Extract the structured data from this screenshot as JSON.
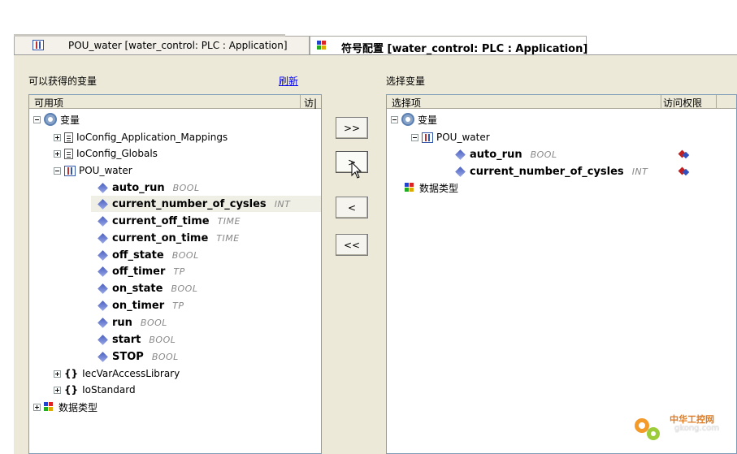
{
  "tabs": [
    {
      "label": "POU_water [water_control: PLC : Application]"
    },
    {
      "label": "符号配置 [water_control: PLC : Application]"
    }
  ],
  "left": {
    "title": "可以获得的变量",
    "refresh_label": "刷新",
    "col_items": "可用项",
    "col_access": "访|",
    "tree": {
      "root": "变量",
      "n1": "IoConfig_Application_Mappings",
      "n2": "IoConfig_Globals",
      "n3": "POU_water",
      "vars": [
        {
          "name": "auto_run",
          "type": "BOOL"
        },
        {
          "name": "current_number_of_cysles",
          "type": "INT"
        },
        {
          "name": "current_off_time",
          "type": "TIME"
        },
        {
          "name": "current_on_time",
          "type": "TIME"
        },
        {
          "name": "off_state",
          "type": "BOOL"
        },
        {
          "name": "off_timer",
          "type": "TP"
        },
        {
          "name": "on_state",
          "type": "BOOL"
        },
        {
          "name": "on_timer",
          "type": "TP"
        },
        {
          "name": "run",
          "type": "BOOL"
        },
        {
          "name": "start",
          "type": "BOOL"
        },
        {
          "name": "STOP",
          "type": "BOOL"
        }
      ],
      "n4": "IecVarAccessLibrary",
      "n5": "IoStandard",
      "datatypes": "数据类型"
    }
  },
  "buttons": {
    "add_all": ">>",
    "add": ">",
    "remove": "<",
    "remove_all": "<<"
  },
  "right": {
    "title": "选择变量",
    "col_items": "选择项",
    "col_access": "访问权限",
    "tree": {
      "root": "变量",
      "pou": "POU_water",
      "vars": [
        {
          "name": "auto_run",
          "type": "BOOL"
        },
        {
          "name": "current_number_of_cysles",
          "type": "INT"
        }
      ],
      "datatypes": "数据类型"
    }
  },
  "watermark": {
    "line1": "中华工控网",
    "line2": "gkong.com"
  }
}
